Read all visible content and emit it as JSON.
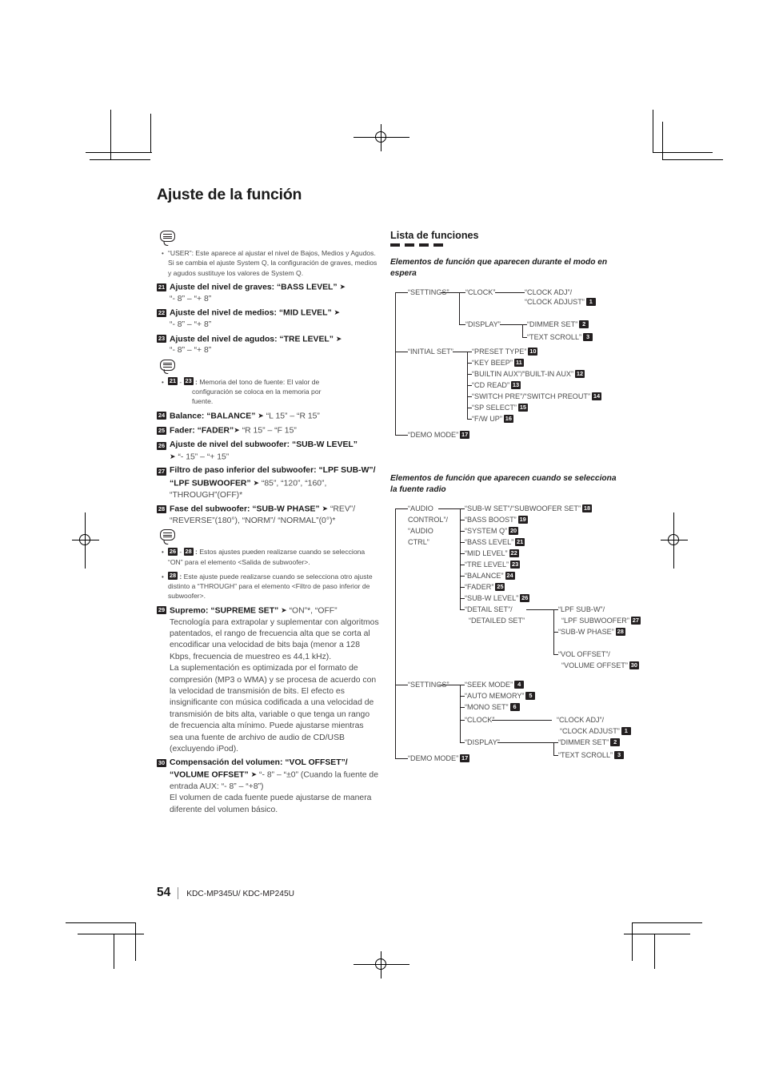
{
  "page": {
    "title": "Ajuste de la función",
    "number": "54",
    "model": "KDC-MP345U/ KDC-MP245U"
  },
  "left_column": {
    "first_note": {
      "bullet": "•",
      "text": "“USER”: Este aparece al ajustar el nivel de Bajos, Medios y Agudos. Si se cambia el ajuste System Q, la configuración de graves, medios y agudos sustituye los valores de System Q."
    },
    "items": [
      {
        "num": "21",
        "bold": "Ajuste del nivel de graves: “BASS LEVEL”",
        "arrow": "➤",
        "light": "“- 8” – “+ 8”"
      },
      {
        "num": "22",
        "bold": "Ajuste del nivel de medios: “MID LEVEL”",
        "arrow": "➤",
        "light": "“- 8” – “+ 8”"
      },
      {
        "num": "23",
        "bold": "Ajuste del nivel de agudos: “TRE LEVEL”",
        "arrow": "➤",
        "light": "“- 8” – “+ 8”"
      }
    ],
    "note_2": {
      "bullet": "•",
      "range_from": "21",
      "range_dash": "-",
      "range_to": "23",
      "colon": ":",
      "text": "Memoria del tono de fuente: El valor de",
      "text_line2": "configuración se coloca en la memoria por",
      "text_line3": "fuente."
    },
    "items_2": [
      {
        "num": "24",
        "bold": "Balance: “BALANCE”",
        "arrow": "➤",
        "light": "“L 15” – “R 15”"
      },
      {
        "num": "25",
        "bold": "Fader: “FADER”",
        "arrow": "➤",
        "light": "“R 15” – “F 15”"
      },
      {
        "num": "26",
        "bold": "Ajuste de nivel del subwoofer: “SUB-W LEVEL”",
        "arrow": "➤",
        "light": "“- 15” – “+ 15”"
      },
      {
        "num": "27",
        "bold": "Filtro de paso inferior del subwoofer: “LPF SUB-W”/ “LPF SUBWOOFER”",
        "arrow": "➤",
        "light": "“85”, “120”, “160”, “THROUGH”(OFF)*"
      },
      {
        "num": "28",
        "bold": "Fase del subwoofer: “SUB-W PHASE”",
        "arrow": "➤",
        "light": "“REV”/ “REVERSE”(180°), “NORM”/ “NORMAL”(0°)*"
      }
    ],
    "note_3": {
      "bullet": "•",
      "range_from": "26",
      "range_dash": "-",
      "range_to": "28",
      "colon": ":",
      "text": "Estos ajustes pueden realizarse cuando se selecciona “ON” para el elemento <Salida de subwoofer>."
    },
    "note_4": {
      "bullet": "•",
      "num": "28",
      "colon": ":",
      "text": "Este ajuste puede realizarse cuando se selecciona otro ajuste distinto a “THROUGH” para el elemento <Filtro de paso inferior de subwoofer>."
    },
    "items_3": [
      {
        "num": "29",
        "bold": "Supremo: “SUPREME SET”",
        "arrow": "➤",
        "light": "“ON”*, “OFF”",
        "paragraph": "Tecnología para extrapolar y suplementar con algoritmos patentados, el rango de frecuencia alta que se corta al encodificar una velocidad de bits baja (menor a 128 Kbps, frecuencia de muestreo es 44,1 kHz).\nLa suplementación es optimizada por el formato de compresión (MP3 o WMA) y se procesa de acuerdo con la velocidad de transmisión de bits. El efecto es insignificante con música codificada a una velocidad de transmisión de bits alta, variable o que tenga un rango de frecuencia alta mínimo. Puede ajustarse mientras sea una fuente de archivo de audio de CD/USB (excluyendo iPod)."
      },
      {
        "num": "30",
        "bold": "Compensación del volumen: “VOL OFFSET”/ “VOLUME OFFSET”",
        "arrow": "➤",
        "light": "“- 8” – “±0” (Cuando la fuente de entrada AUX: “- 8” – “+8”)",
        "paragraph": "El volumen de cada fuente puede ajustarse de manera diferente del volumen básico."
      }
    ]
  },
  "right_column": {
    "section_title": "Lista de funciones",
    "standby": {
      "subsection": "Elementos de función que aparecen durante el modo en espera",
      "nodes": {
        "settings": "“SETTINGS”",
        "clock": "“CLOCK”",
        "clock_adj_1": "“CLOCK ADJ”/",
        "clock_adj_2": "“CLOCK ADJUST”",
        "clock_adj_badge": "1",
        "display": "“DISPLAY”",
        "dimmer": "“DIMMER SET”",
        "dimmer_badge": "2",
        "text_scroll": "“TEXT SCROLL”",
        "text_scroll_badge": "3",
        "initial_set": "“INITIAL SET”",
        "preset_type": "“PRESET TYPE”",
        "preset_type_badge": "10",
        "key_beep": "“KEY BEEP”",
        "key_beep_badge": "11",
        "builtin_aux": "“BUILTIN AUX”/“BUILT-IN AUX”",
        "builtin_aux_badge": "12",
        "cd_read": "“CD READ”",
        "cd_read_badge": "13",
        "switch_pre": "“SWITCH PRE”/“SWITCH PREOUT”",
        "switch_pre_badge": "14",
        "sp_select": "“SP SELECT”",
        "sp_select_badge": "15",
        "fw_up": "“F/W UP”",
        "fw_up_badge": "16",
        "demo_mode": "“DEMO MODE”",
        "demo_mode_badge": "17"
      }
    },
    "radio": {
      "subsection": "Elementos de función que aparecen cuando se selecciona la fuente radio",
      "nodes": {
        "audio_control_1": "“AUDIO",
        "audio_control_2": "CONTROL”/",
        "audio_control_3": "“AUDIO",
        "audio_control_4": "CTRL”",
        "sub_w_set": "“SUB-W SET”/“SUBWOOFER SET”",
        "sub_w_set_badge": "18",
        "bass_boost": "“BASS BOOST”",
        "bass_boost_badge": "19",
        "system_q": "“SYSTEM Q”",
        "system_q_badge": "20",
        "bass_level": "“BASS LEVEL”",
        "bass_level_badge": "21",
        "mid_level": "“MID LEVEL”",
        "mid_level_badge": "22",
        "tre_level": "“TRE LEVEL”",
        "tre_level_badge": "23",
        "balance": "“BALANCE”",
        "balance_badge": "24",
        "fader": "“FADER”",
        "fader_badge": "25",
        "sub_w_level": "“SUB-W LEVEL”",
        "sub_w_level_badge": "26",
        "detail_set_1": "“DETAIL SET”/",
        "detail_set_2": "“DETAILED SET”",
        "lpf_1": "“LPF SUB-W”/",
        "lpf_2": "“LPF SUBWOOFER”",
        "lpf_badge": "27",
        "sub_w_phase": "“SUB-W PHASE”",
        "sub_w_phase_badge": "28",
        "vol_offset_1": "“VOL OFFSET”/",
        "vol_offset_2": "“VOLUME OFFSET”",
        "vol_offset_badge": "30",
        "settings": "“SETTINGS”",
        "seek_mode": "“SEEK MODE”",
        "seek_mode_badge": "4",
        "auto_memory": "“AUTO MEMORY”",
        "auto_memory_badge": "5",
        "mono_set": "“MONO SET”",
        "mono_set_badge": "6",
        "clock": "“CLOCK”",
        "clock_adj_1": "“CLOCK ADJ”/",
        "clock_adj_2": "“CLOCK ADJUST”",
        "clock_adj_badge": "1",
        "display": "“DISPLAY”",
        "dimmer": "“DIMMER SET”",
        "dimmer_badge": "2",
        "text_scroll": "“TEXT SCROLL”",
        "text_scroll_badge": "3",
        "demo_mode": "“DEMO MODE”",
        "demo_mode_badge": "17"
      }
    }
  }
}
